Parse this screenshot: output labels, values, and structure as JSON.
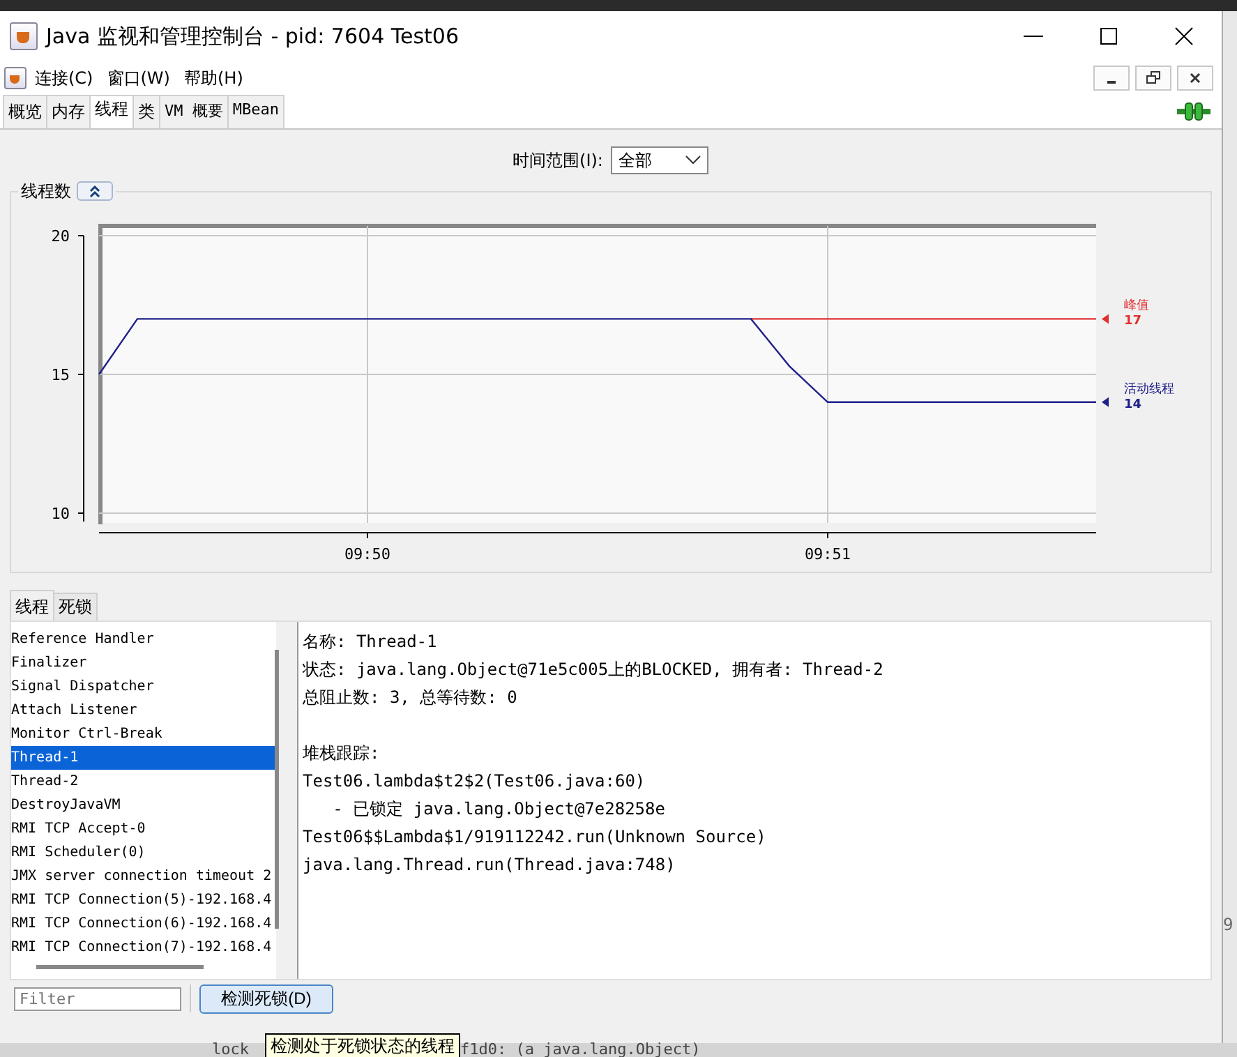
{
  "window": {
    "title": "Java 监视和管理控制台 - pid: 7604 Test06"
  },
  "menu": [
    {
      "label": "连接(C)"
    },
    {
      "label": "窗口(W)"
    },
    {
      "label": "帮助(H)"
    }
  ],
  "tabs": [
    {
      "label": "概览",
      "selected": false
    },
    {
      "label": "内存",
      "selected": false
    },
    {
      "label": "线程",
      "selected": true
    },
    {
      "label": "类",
      "selected": false
    },
    {
      "label": "VM 概要",
      "selected": false
    },
    {
      "label": "MBean",
      "selected": false
    }
  ],
  "time_range": {
    "label": "时间范围(I):",
    "value": "全部"
  },
  "chart_panel": {
    "title": "线程数",
    "chart_data": {
      "type": "line",
      "categories": [
        null,
        null,
        null,
        null,
        null,
        null,
        null,
        "09:50",
        null,
        null,
        null,
        null,
        null,
        null,
        null,
        null,
        null,
        null,
        null,
        "09:51",
        null,
        null,
        null,
        null,
        null,
        null,
        null
      ],
      "ylim": [
        10,
        20
      ],
      "yticks": [
        10,
        15,
        20
      ],
      "grid": true,
      "series": [
        {
          "name": "峰值",
          "color": "#e03030",
          "values": [
            null,
            null,
            null,
            null,
            null,
            null,
            null,
            null,
            null,
            null,
            null,
            null,
            null,
            null,
            null,
            null,
            null,
            17,
            17,
            17,
            17,
            17,
            17,
            17,
            17,
            17,
            17
          ]
        },
        {
          "name": "活动线程",
          "color": "#20208a",
          "values": [
            15,
            17,
            17,
            17,
            17,
            17,
            17,
            17,
            17,
            17,
            17,
            17,
            17,
            17,
            17,
            17,
            17,
            17,
            15.3,
            14,
            14,
            14,
            14,
            14,
            14,
            14,
            14
          ]
        }
      ]
    },
    "legend_values": [
      "17",
      "14"
    ]
  },
  "lower_tabs": [
    {
      "label": "线程",
      "selected": true
    },
    {
      "label": "死锁",
      "selected": false
    }
  ],
  "threads": [
    {
      "name": "Reference Handler",
      "selected": false
    },
    {
      "name": "Finalizer",
      "selected": false
    },
    {
      "name": "Signal Dispatcher",
      "selected": false
    },
    {
      "name": "Attach Listener",
      "selected": false
    },
    {
      "name": "Monitor Ctrl-Break",
      "selected": false
    },
    {
      "name": "Thread-1",
      "selected": true
    },
    {
      "name": "Thread-2",
      "selected": false
    },
    {
      "name": "DestroyJavaVM",
      "selected": false
    },
    {
      "name": "RMI TCP Accept-0",
      "selected": false
    },
    {
      "name": "RMI Scheduler(0)",
      "selected": false
    },
    {
      "name": "JMX server connection timeout 2",
      "selected": false
    },
    {
      "name": "RMI TCP Connection(5)-192.168.4",
      "selected": false
    },
    {
      "name": "RMI TCP Connection(6)-192.168.4",
      "selected": false
    },
    {
      "name": "RMI TCP Connection(7)-192.168.4",
      "selected": false
    }
  ],
  "details": [
    "名称: Thread-1",
    "状态: java.lang.Object@71e5c005上的BLOCKED, 拥有者: Thread-2",
    "总阻止数: 3, 总等待数: 0"
  ],
  "stack_trace": [
    "堆栈跟踪:",
    "Test06.lambda$t2$2(Test06.java:60)",
    "   - 已锁定 java.lang.Object@7e28258e",
    "Test06$$Lambda$1/919112242.run(Unknown Source)",
    "java.lang.Thread.run(Thread.java:748)"
  ],
  "filter": {
    "placeholder": "Filter"
  },
  "detect_button": {
    "label": "检测死锁(D)"
  },
  "tooltip": {
    "text": "检测处于死锁状态的线程"
  },
  "background": {
    "text_1": "lock",
    "text_2": "f1d0: (a java.lang.Object)",
    "text_3": "9"
  }
}
